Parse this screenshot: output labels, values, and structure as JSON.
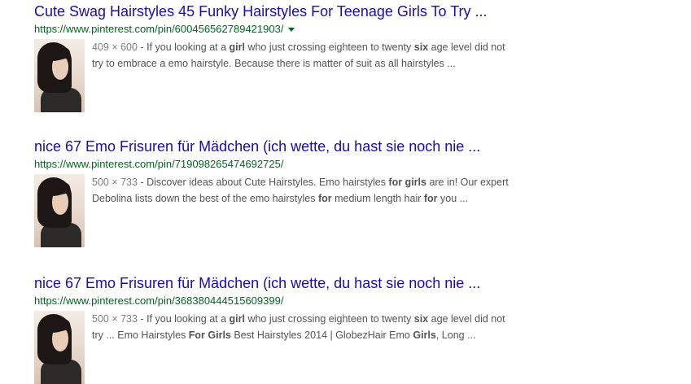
{
  "results": [
    {
      "title": "Cute Swag Hairstyles 45 Funky Hairstyles For Teenage Girls To Try ...",
      "url": "https://www.pinterest.com/pin/600456562789421903/",
      "dims": "409 × 600",
      "has_dropdown": true,
      "snippet_line1": [
        {
          "t": " - If you looking at a ",
          "b": false
        },
        {
          "t": "girl",
          "b": true
        },
        {
          "t": " who just crossing eighteen to twenty ",
          "b": false
        },
        {
          "t": "six",
          "b": true
        },
        {
          "t": " age level did not",
          "b": false
        }
      ],
      "snippet_line2": [
        {
          "t": "try to embrace a emo hairstyle. Because there is matter of suit as all hairstyles ...",
          "b": false
        }
      ]
    },
    {
      "title": "nice 67 Emo Frisuren für Mädchen (ich wette, du hast sie noch nie ...",
      "url": "https://www.pinterest.com/pin/719098265474692725/",
      "dims": "500 × 733",
      "has_dropdown": false,
      "snippet_line1": [
        {
          "t": " - Discover ideas about Cute Hairstyles. Emo hairstyles ",
          "b": false
        },
        {
          "t": "for girls",
          "b": true
        },
        {
          "t": " are in! Our expert",
          "b": false
        }
      ],
      "snippet_line2": [
        {
          "t": "Debolina lists down the best of the emo hairstyles ",
          "b": false
        },
        {
          "t": "for",
          "b": true
        },
        {
          "t": " medium length hair ",
          "b": false
        },
        {
          "t": "for",
          "b": true
        },
        {
          "t": " you ...",
          "b": false
        }
      ]
    },
    {
      "title": "nice 67 Emo Frisuren für Mädchen (ich wette, du hast sie noch nie ...",
      "url": "https://www.pinterest.com/pin/368380444515609399/",
      "dims": "500 × 733",
      "has_dropdown": false,
      "snippet_line1": [
        {
          "t": " - If you looking at a ",
          "b": false
        },
        {
          "t": "girl",
          "b": true
        },
        {
          "t": " who just crossing eighteen to twenty ",
          "b": false
        },
        {
          "t": "six",
          "b": true
        },
        {
          "t": " age level did not",
          "b": false
        }
      ],
      "snippet_line2": [
        {
          "t": "try ... Emo Hairstyles ",
          "b": false
        },
        {
          "t": "For Girls",
          "b": true
        },
        {
          "t": " Best Hairstyles 2014 | GlobezHair Emo ",
          "b": false
        },
        {
          "t": "Girls",
          "b": true
        },
        {
          "t": ", Long ...",
          "b": false
        }
      ]
    }
  ]
}
